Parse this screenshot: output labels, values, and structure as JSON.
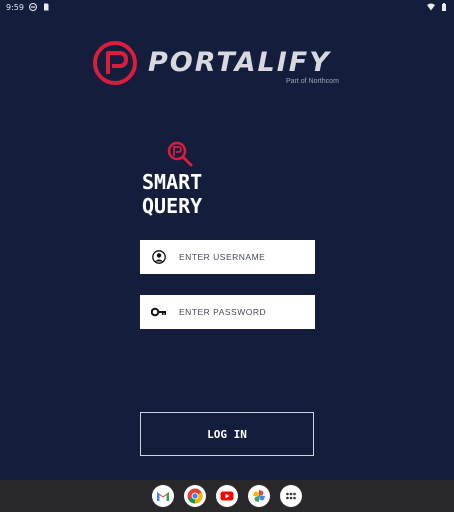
{
  "status_bar": {
    "time": "9:59"
  },
  "brand": {
    "name": "PORTALIFY",
    "tagline": "Part of Northcom",
    "accent_color": "#d81e3c"
  },
  "app": {
    "title_line1": "SMART",
    "title_line2": "QUERY"
  },
  "form": {
    "username_placeholder": "ENTER USERNAME",
    "password_placeholder": "ENTER PASSWORD",
    "login_label": "LOG IN"
  },
  "dock": {
    "apps": [
      "gmail-icon",
      "chrome-icon",
      "youtube-icon",
      "photos-icon",
      "app-drawer-icon"
    ]
  }
}
